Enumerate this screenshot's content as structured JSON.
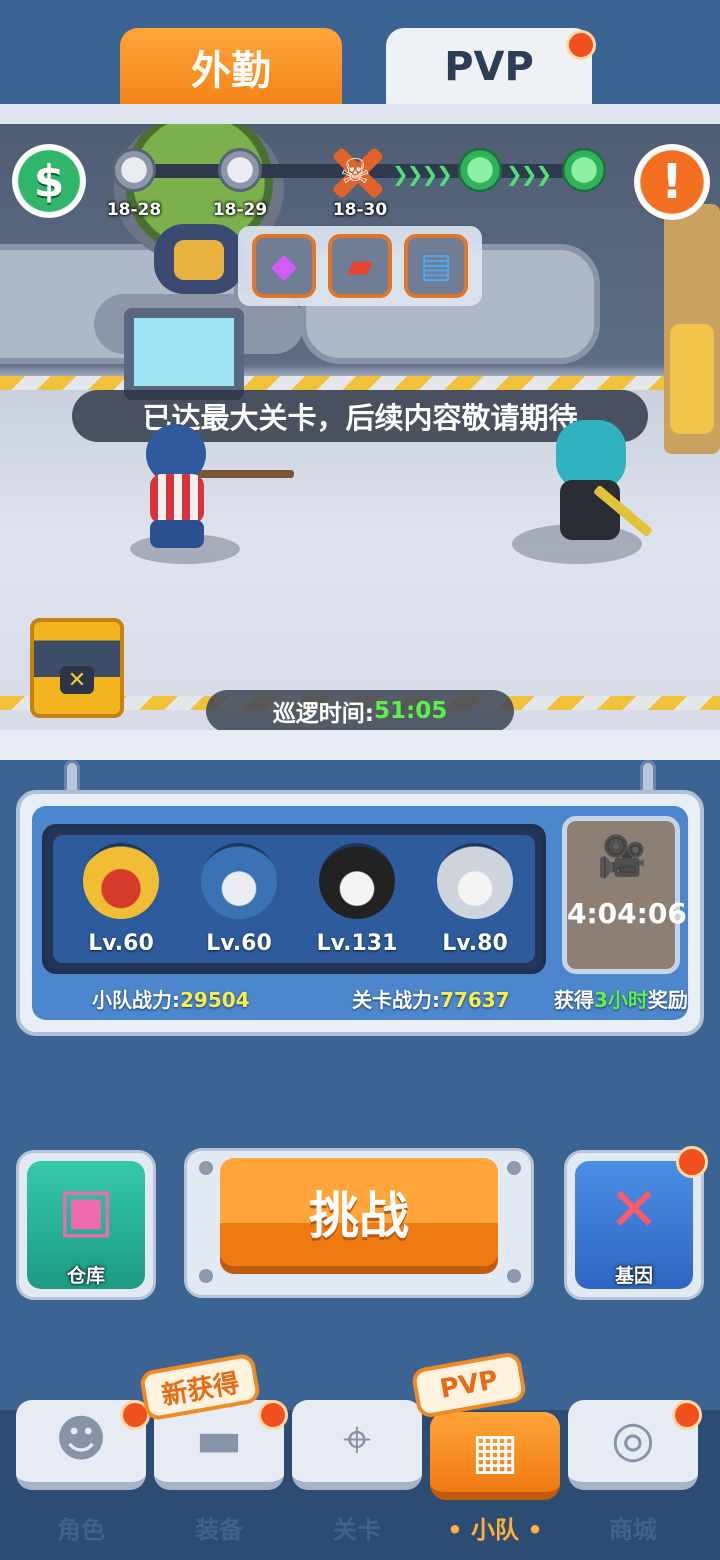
{
  "tabs": [
    {
      "label": "外勤",
      "active": true
    },
    {
      "label": "PVP",
      "active": false,
      "has_dot": true
    }
  ],
  "scene": {
    "levels": [
      {
        "label": "18-28",
        "state": "done"
      },
      {
        "label": "18-29",
        "state": "done"
      },
      {
        "label": "18-30",
        "state": "boss"
      },
      {
        "label": "",
        "state": "next"
      },
      {
        "label": "",
        "state": "next"
      }
    ],
    "coin_button_glyph": "$",
    "alert_button_glyph": "!",
    "rewards": [
      {
        "icon": "gem-icon",
        "glyph": "◆"
      },
      {
        "icon": "red-card-icon",
        "glyph": "▰"
      },
      {
        "icon": "blue-card-icon",
        "glyph": "▤"
      }
    ],
    "notice": "已达最大关卡，后续内容敬请期待",
    "patrol_label": "巡逻时间:",
    "patrol_time": "51:05",
    "boss_glyph": "☠",
    "chest_glyph": "✕"
  },
  "squad": {
    "members": [
      {
        "level": "Lv.60"
      },
      {
        "level": "Lv.60"
      },
      {
        "level": "Lv.131"
      },
      {
        "level": "Lv.80"
      }
    ],
    "video_timer": "4:04:06",
    "video_glyph": "🎥",
    "team_power_label": "小队战力:",
    "team_power_value": "29504",
    "stage_power_label": "关卡战力:",
    "stage_power_value": "77637",
    "reward_prefix": "获得",
    "reward_hours": "3小时",
    "reward_suffix": "奖励"
  },
  "actions": {
    "warehouse_label": "仓库",
    "challenge_label": "挑战",
    "gene_label": "基因"
  },
  "nav": {
    "items": [
      {
        "label": "角色",
        "glyph": "☻",
        "active": false,
        "has_dot": true
      },
      {
        "label": "装备",
        "glyph": "▬",
        "active": false,
        "has_dot": true
      },
      {
        "label": "关卡",
        "glyph": "⌖",
        "active": false,
        "has_dot": false
      },
      {
        "label": "• 小队 •",
        "glyph": "▦",
        "active": true,
        "has_dot": false
      },
      {
        "label": "商城",
        "glyph": "◎",
        "active": false,
        "has_dot": true
      }
    ],
    "new_badge": "新获得",
    "pvp_badge": "PVP"
  },
  "colors": {
    "accent_orange": "#f58418",
    "highlight_green": "#5cf04a",
    "highlight_yellow": "#f7f04a",
    "notification_red": "#f0501d"
  }
}
